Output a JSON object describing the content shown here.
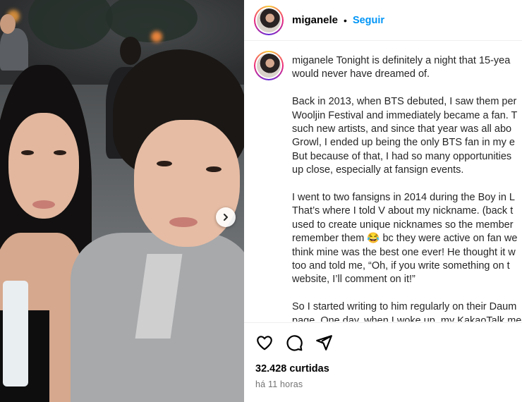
{
  "post": {
    "username": "miganele",
    "separator": "•",
    "follow_label": "Seguir",
    "caption_lines": [
      "Tonight is definitely a night that 15-yea",
      "would never have dreamed of.",
      "",
      "Back in 2013, when BTS debuted, I saw them per",
      "Wooljin Festival and immediately became a fan. T",
      "such new artists, and since that year was all abo",
      "Growl, I ended up being the only BTS fan in my e",
      "But because of that, I had so many opportunities",
      "up close, especially at fansign events.",
      "",
      "I went to two fansigns in 2014 during the Boy in L",
      "That’s where I told V about my nickname. (back t",
      "used to create unique nicknames so the member",
      "remember them 😂 bc they were active on fan we",
      "think mine was the best one ever! He thought it w",
      "too and told me, “Oh, if you write something on t",
      "website, I’ll comment on it!”",
      "",
      "So I started writing to him regularly on their Daum",
      "page. One day, when I woke up, my KakaoTalk me"
    ],
    "likes": "32.428 curtidas",
    "time_ago": "há 11 horas"
  },
  "icons": {
    "like": "heart-icon",
    "comment": "comment-icon",
    "share": "share-icon",
    "next": "chevron-right-icon"
  },
  "colors": {
    "follow": "#0095f6",
    "meta": "#737373",
    "ring_start": "#f9ce34",
    "ring_mid": "#ee2a7b",
    "ring_end": "#6228d7"
  }
}
